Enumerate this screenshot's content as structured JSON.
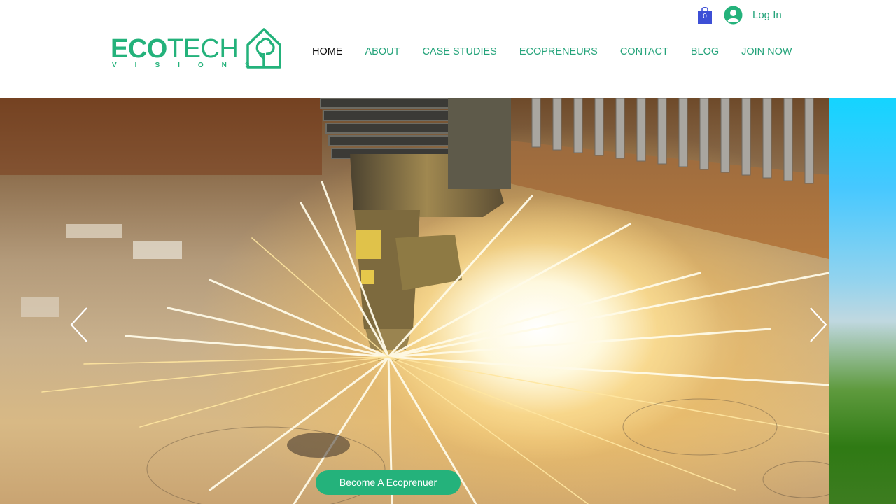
{
  "brand": {
    "name_bold": "ECO",
    "name_light": "TECH",
    "tagline": "VISIONS",
    "color": "#24b27b"
  },
  "nav": {
    "items": [
      {
        "label": "HOME",
        "active": true
      },
      {
        "label": "ABOUT"
      },
      {
        "label": "CASE STUDIES"
      },
      {
        "label": "ECOPRENEURS"
      },
      {
        "label": "CONTACT"
      },
      {
        "label": "BLOG"
      },
      {
        "label": "JOIN NOW"
      }
    ]
  },
  "cart": {
    "count": "0",
    "icon": "shopping-bag-icon",
    "color": "#3d4fd6"
  },
  "login": {
    "label": "Log In",
    "icon": "user-avatar-icon"
  },
  "slideshow": {
    "prev_icon": "chevron-left-icon",
    "next_icon": "chevron-right-icon",
    "cta_label": "Become A Ecoprenuer"
  }
}
